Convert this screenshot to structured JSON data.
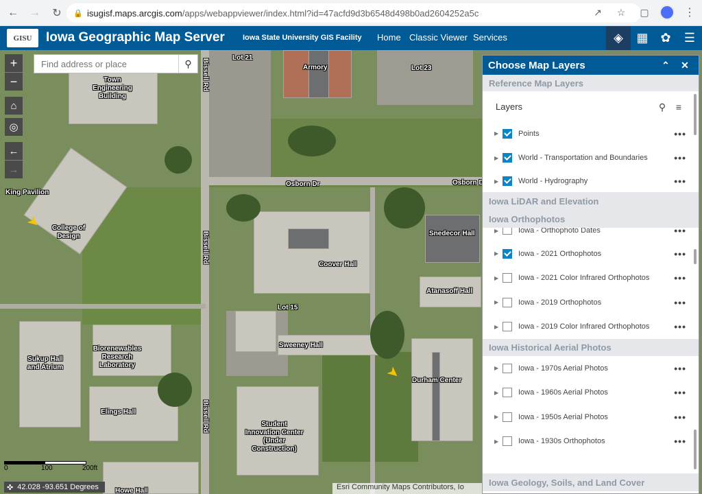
{
  "browser": {
    "url_host": "isugisf.maps.arcgis.com",
    "url_path": "/apps/webappviewer/index.html?id=47acfd9d3b6548d498b0ad2604252a5c"
  },
  "header": {
    "logo_text": "GISU",
    "title": "Iowa Geographic Map Server",
    "subtitle": "Iowa State University GIS Facility",
    "links": [
      "Home",
      "Classic Viewer",
      "Services"
    ]
  },
  "search": {
    "placeholder": "Find address or place"
  },
  "map": {
    "labels": {
      "lot21": "Lot 21",
      "armory": "Armory",
      "lot23": "Lot 23",
      "engineering": "Town Engineering Building",
      "bissell1": "Bissell Rd",
      "bissell2": "Bissell Rd",
      "bissell3": "Bissell Rd",
      "king": "King Pavilion",
      "osborn1": "Osborn Dr",
      "osborn2": "Osborn Dr",
      "college": "College of Design",
      "coover": "Coover Hall",
      "snedecor": "Snedecor Hall",
      "atanasoff": "Atanasoff Hall",
      "lot15": "Lot 15",
      "sweeney": "Sweeney Hall",
      "biorenewables": "Biorenewables Research Laboratory",
      "sukup": "Sukup Hall and Atrium",
      "durham": "Durham Center",
      "elings": "Elings Hall",
      "sic": "Student Innovation Center (Under Construction)",
      "howe": "Howe Hall"
    },
    "scale": {
      "zero": "0",
      "mid": "100",
      "end": "200ft"
    },
    "coords": "42.028 -93.651 Degrees",
    "attribution": "Esri Community Maps Contributors, Io"
  },
  "panel": {
    "title": "Choose Map Layers",
    "layers_label": "Layers",
    "groups": [
      {
        "name": "Reference Map Layers",
        "layers": [
          {
            "name": "Points",
            "checked": true
          },
          {
            "name": "World - Transportation and Boundaries",
            "checked": true
          },
          {
            "name": "World - Hydrography",
            "checked": true
          }
        ]
      },
      {
        "name": "Iowa LiDAR and Elevation",
        "layers": []
      },
      {
        "name": "Iowa Orthophotos",
        "layers": [
          {
            "name": "Iowa - Orthophoto Dates",
            "checked": false
          },
          {
            "name": "Iowa - 2021 Orthophotos",
            "checked": true
          },
          {
            "name": "Iowa - 2021 Color Infrared Orthophotos",
            "checked": false
          },
          {
            "name": "Iowa - 2019 Orthophotos",
            "checked": false
          },
          {
            "name": "Iowa - 2019 Color Infrared Orthophotos",
            "checked": false
          }
        ]
      },
      {
        "name": "Iowa Historical Aerial Photos",
        "layers": [
          {
            "name": "Iowa - 1970s Aerial Photos",
            "checked": false
          },
          {
            "name": "Iowa - 1960s Aerial Photos",
            "checked": false
          },
          {
            "name": "Iowa - 1950s Aerial Photos",
            "checked": false
          },
          {
            "name": "Iowa - 1930s Orthophotos",
            "checked": false
          }
        ]
      },
      {
        "name": "Iowa Geology, Soils, and Land Cover",
        "layers": []
      }
    ]
  }
}
